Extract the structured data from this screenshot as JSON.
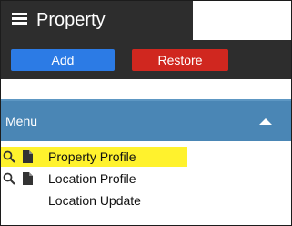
{
  "header": {
    "title": "Property",
    "menu_icon": "hamburger-icon"
  },
  "toolbar": {
    "add_label": "Add",
    "restore_label": "Restore",
    "add_color": "#2c7be5",
    "restore_color": "#d0271f"
  },
  "menu": {
    "title": "Menu",
    "toggle_icon": "caret-up-icon",
    "items": [
      {
        "label": "Property Profile",
        "icons": [
          "search-icon",
          "file-icon"
        ],
        "highlighted": true
      },
      {
        "label": "Location Profile",
        "icons": [
          "search-icon",
          "file-icon"
        ],
        "highlighted": false
      },
      {
        "label": "Location Update",
        "icons": [],
        "highlighted": false
      }
    ]
  },
  "colors": {
    "dark_bar": "#2d2d2d",
    "menu_header": "#4a86b5",
    "highlight": "#fff22d"
  }
}
